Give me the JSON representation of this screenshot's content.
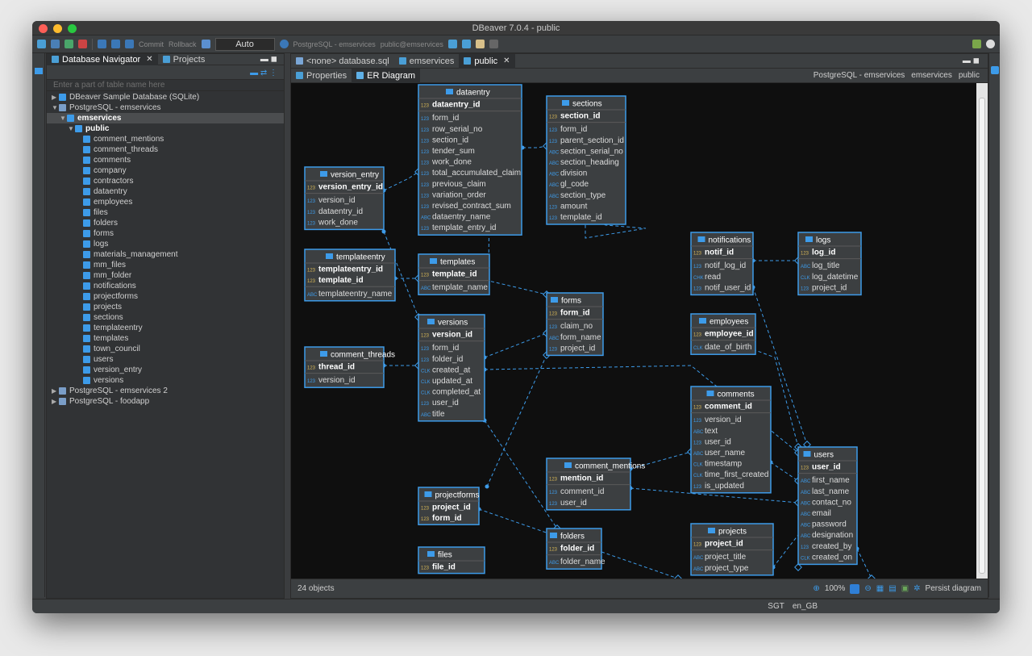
{
  "window": {
    "title": "DBeaver 7.0.4 - public"
  },
  "toolbar": {
    "commit": "Commit",
    "rollback": "Rollback",
    "tx_mode": "Auto",
    "connection": "PostgreSQL - emservices",
    "schema": "public@emservices"
  },
  "navigator": {
    "tabs": [
      {
        "label": "Database Navigator"
      },
      {
        "label": "Projects"
      }
    ],
    "filter_placeholder": "Enter a part of table name here",
    "tree": [
      {
        "label": "DBeaver Sample Database (SQLite)",
        "depth": 0,
        "arrow": "▶",
        "icon": "sqlite-db-icon"
      },
      {
        "label": "PostgreSQL - emservices",
        "depth": 0,
        "arrow": "▼",
        "icon": "postgres-icon"
      },
      {
        "label": "emservices",
        "depth": 1,
        "arrow": "▼",
        "icon": "database-icon",
        "selected": true,
        "bold": true
      },
      {
        "label": "public",
        "depth": 2,
        "arrow": "▼",
        "icon": "schema-icon",
        "bold": true
      },
      {
        "label": "comment_mentions",
        "depth": 3
      },
      {
        "label": "comment_threads",
        "depth": 3
      },
      {
        "label": "comments",
        "depth": 3
      },
      {
        "label": "company",
        "depth": 3
      },
      {
        "label": "contractors",
        "depth": 3
      },
      {
        "label": "dataentry",
        "depth": 3
      },
      {
        "label": "employees",
        "depth": 3
      },
      {
        "label": "files",
        "depth": 3
      },
      {
        "label": "folders",
        "depth": 3
      },
      {
        "label": "forms",
        "depth": 3
      },
      {
        "label": "logs",
        "depth": 3
      },
      {
        "label": "materials_management",
        "depth": 3
      },
      {
        "label": "mm_files",
        "depth": 3
      },
      {
        "label": "mm_folder",
        "depth": 3
      },
      {
        "label": "notifications",
        "depth": 3
      },
      {
        "label": "projectforms",
        "depth": 3
      },
      {
        "label": "projects",
        "depth": 3
      },
      {
        "label": "sections",
        "depth": 3
      },
      {
        "label": "templateentry",
        "depth": 3
      },
      {
        "label": "templates",
        "depth": 3
      },
      {
        "label": "town_council",
        "depth": 3
      },
      {
        "label": "users",
        "depth": 3
      },
      {
        "label": "version_entry",
        "depth": 3
      },
      {
        "label": "versions",
        "depth": 3
      },
      {
        "label": "PostgreSQL - emservices 2",
        "depth": 0,
        "arrow": "▶",
        "icon": "postgres-icon"
      },
      {
        "label": "PostgreSQL - foodapp",
        "depth": 0,
        "arrow": "▶",
        "icon": "postgres-icon"
      }
    ]
  },
  "editor": {
    "tabs": [
      {
        "label": "<none> database.sql"
      },
      {
        "label": "emservices"
      },
      {
        "label": "public"
      }
    ],
    "subtabs": [
      {
        "label": "Properties"
      },
      {
        "label": "ER Diagram"
      }
    ],
    "breadcrumbs": [
      {
        "label": "PostgreSQL - emservices"
      },
      {
        "label": "emservices"
      },
      {
        "label": "public"
      }
    ],
    "status": {
      "objects": "24 objects",
      "zoom": "100%",
      "persist": "Persist diagram"
    }
  },
  "statusbar": {
    "timezone": "SGT",
    "locale": "en_GB"
  },
  "colors": {
    "accent": "#3d9be9",
    "entity_bg": "#3c3f41",
    "canvas_bg": "#0f0f0f"
  },
  "er": {
    "entities": [
      {
        "name": "dataentry",
        "pk": [
          "dataentry_id"
        ],
        "pkicons": [
          "123"
        ],
        "cols": [
          [
            "123",
            "form_id"
          ],
          [
            "123",
            "row_serial_no"
          ],
          [
            "123",
            "section_id"
          ],
          [
            "123",
            "tender_sum"
          ],
          [
            "123",
            "work_done"
          ],
          [
            "123",
            "total_accumulated_claim"
          ],
          [
            "123",
            "previous_claim"
          ],
          [
            "123",
            "variation_order"
          ],
          [
            "123",
            "revised_contract_sum"
          ],
          [
            "ABC",
            "dataentry_name"
          ],
          [
            "123",
            "template_entry_id"
          ]
        ]
      },
      {
        "name": "sections",
        "pk": [
          "section_id"
        ],
        "pkicons": [
          "123"
        ],
        "cols": [
          [
            "123",
            "form_id"
          ],
          [
            "123",
            "parent_section_id"
          ],
          [
            "ABC",
            "section_serial_no"
          ],
          [
            "ABC",
            "section_heading"
          ],
          [
            "ABC",
            "division"
          ],
          [
            "ABC",
            "gl_code"
          ],
          [
            "ABC",
            "section_type"
          ],
          [
            "123",
            "amount"
          ],
          [
            "123",
            "template_id"
          ]
        ]
      },
      {
        "name": "version_entry",
        "pk": [
          "version_entry_id"
        ],
        "pkicons": [
          "123"
        ],
        "cols": [
          [
            "123",
            "version_id"
          ],
          [
            "123",
            "dataentry_id"
          ],
          [
            "123",
            "work_done"
          ]
        ]
      },
      {
        "name": "templateentry",
        "pk": [
          "templateentry_id",
          "template_id"
        ],
        "pkicons": [
          "123",
          "123"
        ],
        "cols": [
          [
            "ABC",
            "templateentry_name"
          ]
        ]
      },
      {
        "name": "templates",
        "pk": [
          "template_id"
        ],
        "pkicons": [
          "123"
        ],
        "cols": [
          [
            "ABC",
            "template_name"
          ]
        ]
      },
      {
        "name": "forms",
        "pk": [
          "form_id"
        ],
        "pkicons": [
          "123"
        ],
        "cols": [
          [
            "123",
            "claim_no"
          ],
          [
            "ABC",
            "form_name"
          ],
          [
            "123",
            "project_id"
          ]
        ]
      },
      {
        "name": "notifications",
        "pk": [
          "notif_id"
        ],
        "pkicons": [
          "123"
        ],
        "cols": [
          [
            "123",
            "notif_log_id"
          ],
          [
            "CHK",
            "read"
          ],
          [
            "123",
            "notif_user_id"
          ]
        ]
      },
      {
        "name": "logs",
        "pk": [
          "log_id"
        ],
        "pkicons": [
          "123"
        ],
        "cols": [
          [
            "ABC",
            "log_title"
          ],
          [
            "CLK",
            "log_datetime"
          ],
          [
            "123",
            "project_id"
          ]
        ]
      },
      {
        "name": "versions",
        "pk": [
          "version_id"
        ],
        "pkicons": [
          "123"
        ],
        "cols": [
          [
            "123",
            "form_id"
          ],
          [
            "123",
            "folder_id"
          ],
          [
            "CLK",
            "created_at"
          ],
          [
            "CLK",
            "updated_at"
          ],
          [
            "CLK",
            "completed_at"
          ],
          [
            "123",
            "user_id"
          ],
          [
            "ABC",
            "title"
          ]
        ]
      },
      {
        "name": "employees",
        "pk": [
          "employee_id"
        ],
        "pkicons": [
          "123"
        ],
        "cols": [
          [
            "CLK",
            "date_of_birth"
          ]
        ]
      },
      {
        "name": "comment_threads",
        "pk": [
          "thread_id"
        ],
        "pkicons": [
          "123"
        ],
        "cols": [
          [
            "123",
            "version_id"
          ]
        ]
      },
      {
        "name": "comments",
        "pk": [
          "comment_id"
        ],
        "pkicons": [
          "123"
        ],
        "cols": [
          [
            "123",
            "version_id"
          ],
          [
            "ABC",
            "text"
          ],
          [
            "123",
            "user_id"
          ],
          [
            "ABC",
            "user_name"
          ],
          [
            "CLK",
            "timestamp"
          ],
          [
            "CLK",
            "time_first_created"
          ],
          [
            "123",
            "is_updated"
          ]
        ]
      },
      {
        "name": "users",
        "pk": [
          "user_id"
        ],
        "pkicons": [
          "123"
        ],
        "cols": [
          [
            "ABC",
            "first_name"
          ],
          [
            "ABC",
            "last_name"
          ],
          [
            "ABC",
            "contact_no"
          ],
          [
            "ABC",
            "email"
          ],
          [
            "ABC",
            "password"
          ],
          [
            "ABC",
            "designation"
          ],
          [
            "123",
            "created_by"
          ],
          [
            "CLK",
            "created_on"
          ]
        ]
      },
      {
        "name": "comment_mentions",
        "pk": [
          "mention_id"
        ],
        "pkicons": [
          "123"
        ],
        "cols": [
          [
            "123",
            "comment_id"
          ],
          [
            "123",
            "user_id"
          ]
        ]
      },
      {
        "name": "projectforms",
        "pk": [
          "project_id",
          "form_id"
        ],
        "pkicons": [
          "123",
          "123"
        ],
        "cols": []
      },
      {
        "name": "projects",
        "pk": [
          "project_id"
        ],
        "pkicons": [
          "123"
        ],
        "cols": [
          [
            "ABC",
            "project_title"
          ],
          [
            "ABC",
            "project_type"
          ]
        ]
      },
      {
        "name": "folders",
        "pk": [
          "folder_id"
        ],
        "pkicons": [
          "123"
        ],
        "cols": [
          [
            "ABC",
            "folder_name"
          ]
        ]
      },
      {
        "name": "files",
        "pk": [
          "file_id"
        ],
        "pkicons": [
          "123"
        ],
        "cols": []
      }
    ]
  }
}
